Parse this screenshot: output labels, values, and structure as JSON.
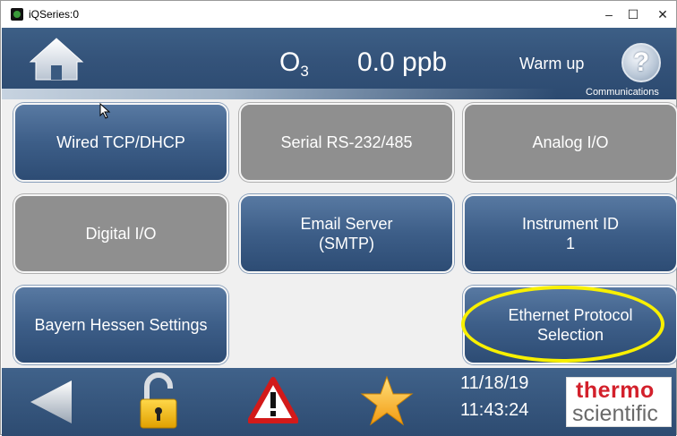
{
  "window": {
    "title": "iQSeries:0",
    "controls": {
      "minimize": "–",
      "maximize": "☐",
      "close": "✕"
    }
  },
  "header": {
    "gas_symbol": "O",
    "gas_subscript": "3",
    "concentration": "0.0 ppb",
    "status": "Warm up",
    "help_glyph": "?",
    "section": "Communications"
  },
  "menu": {
    "wired_tcp": "Wired TCP/DHCP",
    "serial": "Serial RS-232/485",
    "analog": "Analog I/O",
    "digital": "Digital I/O",
    "email_line1": "Email Server",
    "email_line2": "(SMTP)",
    "instrument_line1": "Instrument ID",
    "instrument_line2": "1",
    "bayern": "Bayern Hessen Settings",
    "ethernet_line1": "Ethernet Protocol",
    "ethernet_line2": "Selection"
  },
  "footer": {
    "date": "11/18/19",
    "time": "11:43:24",
    "logo_line1": "thermo",
    "logo_line2": "scientific"
  },
  "colors": {
    "header_blue": "#34537a",
    "button_blue": "#3d5e88",
    "button_gray": "#8f8f8f",
    "highlight": "#f8f000",
    "logo_red": "#d3202b"
  }
}
